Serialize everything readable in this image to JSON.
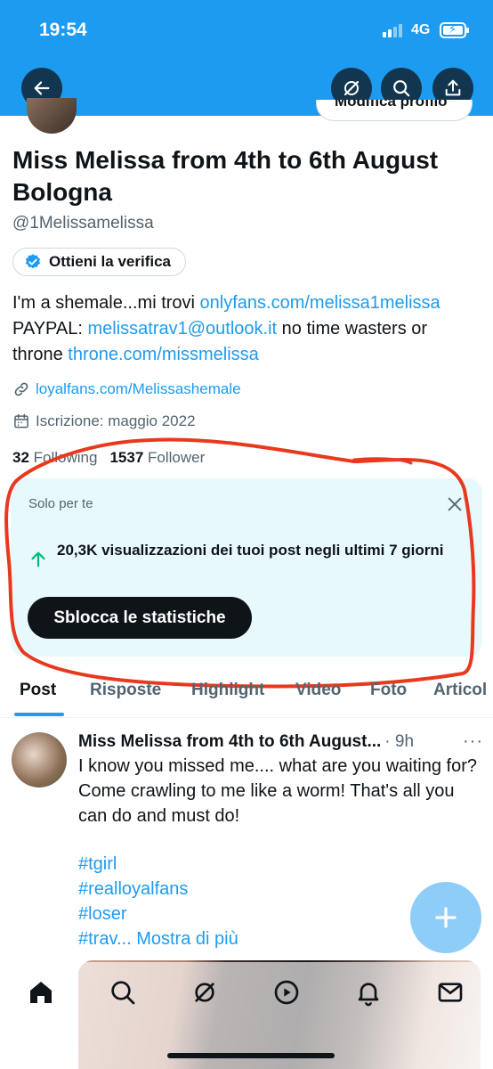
{
  "status_bar": {
    "time": "19:54",
    "network": "4G"
  },
  "profile": {
    "edit_button": "Modifica profilo",
    "name": "Miss Melissa from 4th to 6th August Bologna",
    "handle": "@1Melissamelissa",
    "verify_button": "Ottieni la verifica",
    "bio": {
      "part1": "I'm a shemale...mi trovi ",
      "link1": "onlyfans.com/melissa1melissa",
      "part2": " PAYPAL: ",
      "link2": "melissatrav1@outlook.it",
      "part3": " no time wasters or throne ",
      "link3": "throne.com/missmelissa"
    },
    "website": "loyalfans.com/Melissashemale",
    "joined": "Iscrizione: maggio 2022",
    "following_count": "32",
    "following_label": "Following",
    "followers_count": "1537",
    "followers_label": "Follower"
  },
  "insight_card": {
    "title": "Solo per te",
    "stat": "20,3K visualizzazioni dei tuoi post negli ultimi 7 giorni",
    "button": "Sblocca le statistiche"
  },
  "tabs": [
    "Post",
    "Risposte",
    "Highlight",
    "Video",
    "Foto",
    "Articol"
  ],
  "post": {
    "author": "Miss Melissa from 4th to 6th August...",
    "time": "· 9h",
    "more": "···",
    "text": "I know you missed me.... what are you waiting for? Come crawling to me like a worm! That's all you can do and must do!",
    "hashtags": [
      "#tgirl",
      "#realloyalfans",
      "#loser"
    ],
    "last_hashtag": "#trav...",
    "show_more": "Mostra di più"
  },
  "fab_icon": "plus-icon",
  "colors": {
    "accent": "#1d9bf0",
    "card_bg": "#e8f9fd",
    "annotation": "#e8391e",
    "stat_arrow": "#00ba7c"
  }
}
